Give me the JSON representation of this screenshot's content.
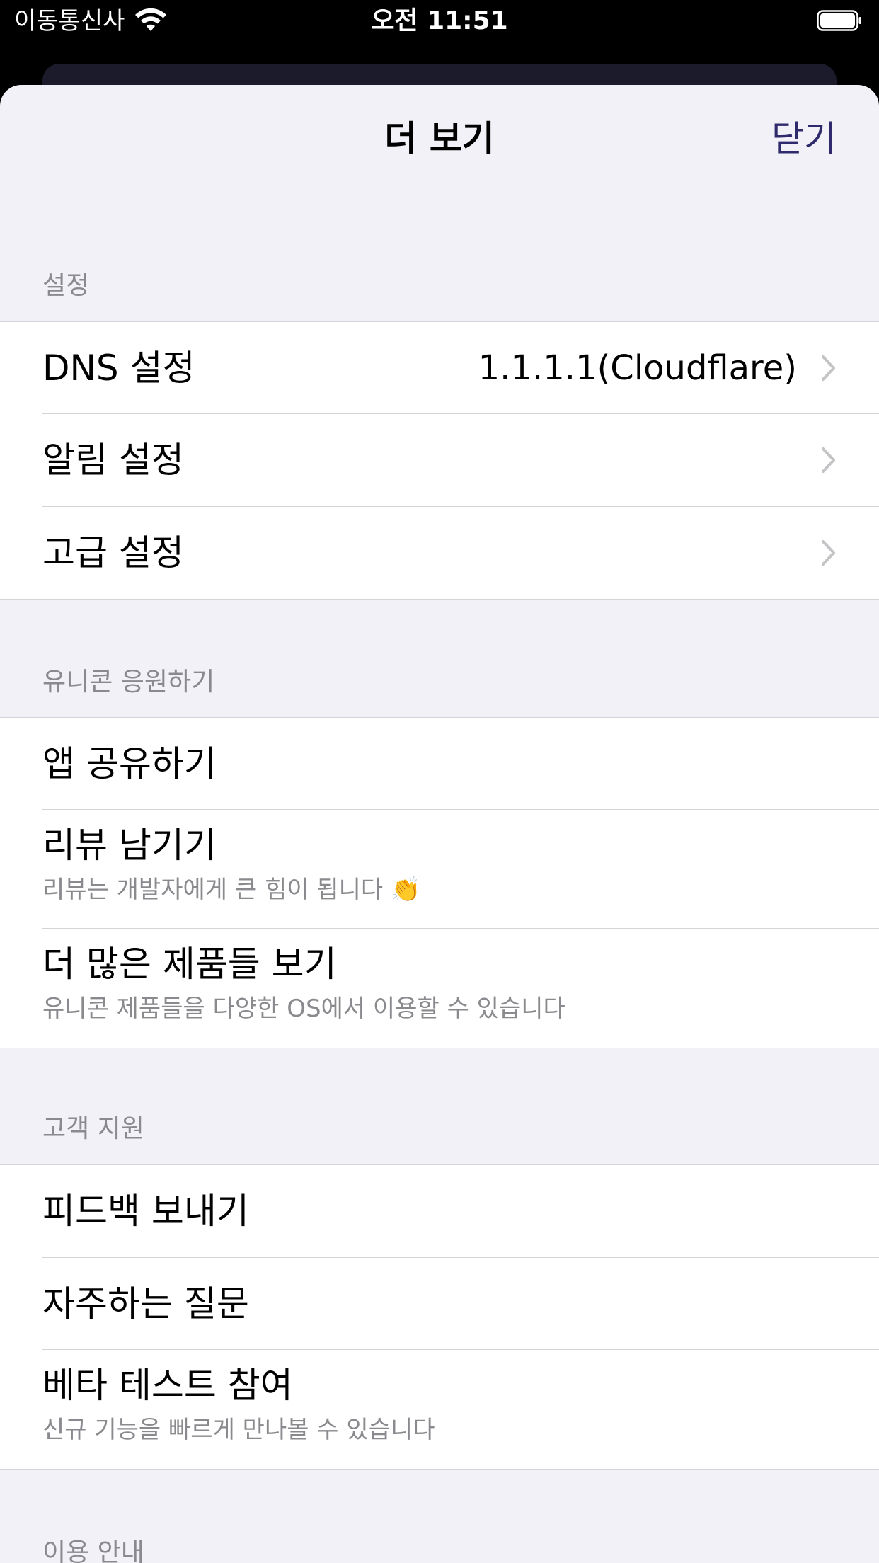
{
  "status_bar": {
    "carrier": "이동통신사",
    "time": "오전 11:51",
    "wifi_icon": "wifi-icon",
    "battery_icon": "battery-icon"
  },
  "sheet": {
    "title": "더 보기",
    "close_label": "닫기",
    "accent_color": "#2f2a6b"
  },
  "sections": [
    {
      "header": "설정",
      "items": [
        {
          "label": "DNS 설정",
          "value": "1.1.1.1(Cloudflare)",
          "icon": "chevron-right-icon"
        },
        {
          "label": "알림 설정",
          "icon": "chevron-right-icon"
        },
        {
          "label": "고급 설정",
          "icon": "chevron-right-icon"
        }
      ]
    },
    {
      "header": "유니콘 응원하기",
      "items": [
        {
          "label": "앱 공유하기"
        },
        {
          "label": "리뷰 남기기",
          "sublabel": "리뷰는 개발자에게 큰 힘이 됩니다 👏"
        },
        {
          "label": "더 많은 제품들 보기",
          "sublabel": "유니콘 제품들을 다양한 OS에서 이용할 수 있습니다"
        }
      ]
    },
    {
      "header": "고객 지원",
      "items": [
        {
          "label": "피드백 보내기"
        },
        {
          "label": "자주하는 질문"
        },
        {
          "label": "베타 테스트 참여",
          "sublabel": "신규 기능을 빠르게 만나볼 수 있습니다"
        }
      ]
    },
    {
      "header": "이용 안내"
    }
  ]
}
